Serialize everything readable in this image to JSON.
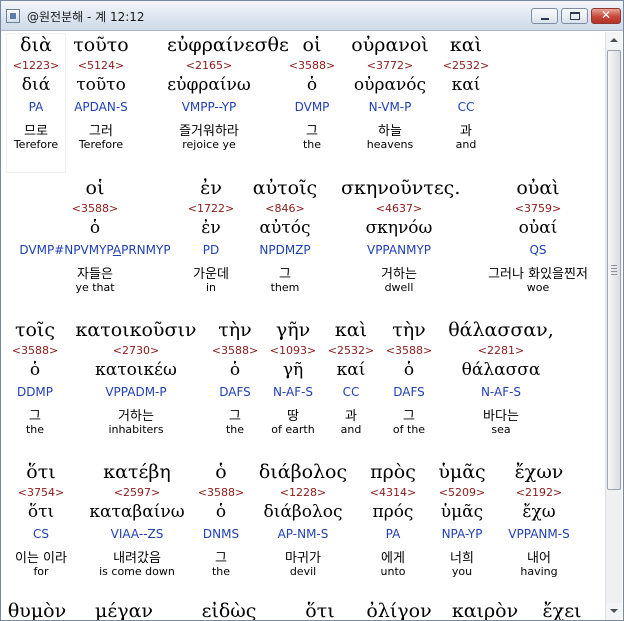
{
  "window": {
    "title": "@원전분해 - 계 12:12",
    "close_glyph": "✕",
    "colors": {
      "number": "#8b1a1a",
      "parsing": "#1f3fb5",
      "titlebar": "#dbe4ef",
      "close_button": "#c8473a"
    }
  },
  "rows": [
    {
      "words": [
        {
          "greek": "διὰ",
          "number": "<1223>",
          "lemma": "διά",
          "parsing": "PA",
          "korean": "므로",
          "english": "Terefore"
        },
        {
          "greek": "τοῦτο",
          "number": "<5124>",
          "lemma": "τοῦτο",
          "parsing": "APDAN-S",
          "korean": "그러",
          "english": "Terefore"
        },
        {
          "greek": "εὐφραίνεσθε",
          "number": "<2165>",
          "lemma": "εὐφραίνω",
          "parsing": "VMPP--YP",
          "korean": "즐거워하라",
          "english": "rejoice ye"
        },
        {
          "greek": "οἱ",
          "number": "<3588>",
          "lemma": "ὁ",
          "parsing": "DVMP",
          "korean": "그",
          "english": "the"
        },
        {
          "greek": "οὐρανοὶ",
          "number": "<3772>",
          "lemma": "οὐρανός",
          "parsing": "N-VM-P",
          "korean": "하늘",
          "english": "heavens"
        },
        {
          "greek": "καὶ",
          "number": "<2532>",
          "lemma": "καί",
          "parsing": "CC",
          "korean": "과",
          "english": "and"
        }
      ]
    },
    {
      "words": [
        {
          "greek": "οἱ",
          "number": "<3588>",
          "lemma": "ὁ",
          "parsing": "DVMP#NPVMYP",
          "parsing_underlined": "A",
          "parsing_rest": "PRNMYP",
          "korean": "자들은",
          "english": "ye that"
        },
        {
          "greek": "ἐν",
          "number": "<1722>",
          "lemma": "ἐν",
          "parsing": "PD",
          "korean": "가운데",
          "english": "in"
        },
        {
          "greek": "αὐτοῖς",
          "number": "<846>",
          "lemma": "αὐτός",
          "parsing": "NPDMZP",
          "korean": "그",
          "english": "them"
        },
        {
          "greek": "σκηνοῦντες.",
          "number": "<4637>",
          "lemma": "σκηνόω",
          "parsing": "VPPANMYP",
          "korean": "거하는",
          "english": "dwell"
        },
        {
          "greek": "οὐαὶ",
          "number": "<3759>",
          "lemma": "οὐαί",
          "parsing": "QS",
          "korean": "그러나 화있을찐저",
          "english": "woe"
        }
      ]
    },
    {
      "words": [
        {
          "greek": "τοῖς",
          "number": "<3588>",
          "lemma": "ὁ",
          "parsing": "DDMP",
          "korean": "그",
          "english": "the"
        },
        {
          "greek": "κατοικοῦσιν",
          "number": "<2730>",
          "lemma": "κατοικέω",
          "parsing": "VPPADM-P",
          "korean": "거하는",
          "english": "inhabiters"
        },
        {
          "greek": "τὴν",
          "number": "<3588>",
          "lemma": "ὁ",
          "parsing": "DAFS",
          "korean": "그",
          "english": "the"
        },
        {
          "greek": "γῆν",
          "number": "<1093>",
          "lemma": "γῆ",
          "parsing": "N-AF-S",
          "korean": "땅",
          "english": "of earth"
        },
        {
          "greek": "καὶ",
          "number": "<2532>",
          "lemma": "καί",
          "parsing": "CC",
          "korean": "과",
          "english": "and"
        },
        {
          "greek": "τὴν",
          "number": "<3588>",
          "lemma": "ὁ",
          "parsing": "DAFS",
          "korean": "그",
          "english": "of the"
        },
        {
          "greek": "θάλασσαν,",
          "number": "<2281>",
          "lemma": "θάλασσα",
          "parsing": "N-AF-S",
          "korean": "바다는",
          "english": "sea"
        }
      ]
    },
    {
      "words": [
        {
          "greek": "ὅτι",
          "number": "<3754>",
          "lemma": "ὅτι",
          "parsing": "CS",
          "korean": "이는 이라",
          "english": "for"
        },
        {
          "greek": "κατέβη",
          "number": "<2597>",
          "lemma": "καταβαίνω",
          "parsing": "VIAA--ZS",
          "korean": "내려갔음",
          "english": "is come down"
        },
        {
          "greek": "ὁ",
          "number": "<3588>",
          "lemma": "ὁ",
          "parsing": "DNMS",
          "korean": "그",
          "english": "the"
        },
        {
          "greek": "διάβολος",
          "number": "<1228>",
          "lemma": "διάβολος",
          "parsing": "AP-NM-S",
          "korean": "마귀가",
          "english": "devil"
        },
        {
          "greek": "πρὸς",
          "number": "<4314>",
          "lemma": "πρός",
          "parsing": "PA",
          "korean": "에게",
          "english": "unto"
        },
        {
          "greek": "ὑμᾶς",
          "number": "<5209>",
          "lemma": "ὑμᾶς",
          "parsing": "NPA-YP",
          "korean": "너희",
          "english": "you"
        },
        {
          "greek": "ἔχων",
          "number": "<2192>",
          "lemma": "ἔχω",
          "parsing": "VPPANM-S",
          "korean": "내어",
          "english": "having"
        }
      ]
    },
    {
      "words": [
        {
          "greek": "θυμὸν"
        },
        {
          "greek": "μέγαν"
        },
        {
          "greek": "εἰδὼς"
        },
        {
          "greek": "ὅτι"
        },
        {
          "greek": "ὀλίγον"
        },
        {
          "greek": "καιρὸν"
        },
        {
          "greek": "ἔχει"
        }
      ]
    }
  ]
}
